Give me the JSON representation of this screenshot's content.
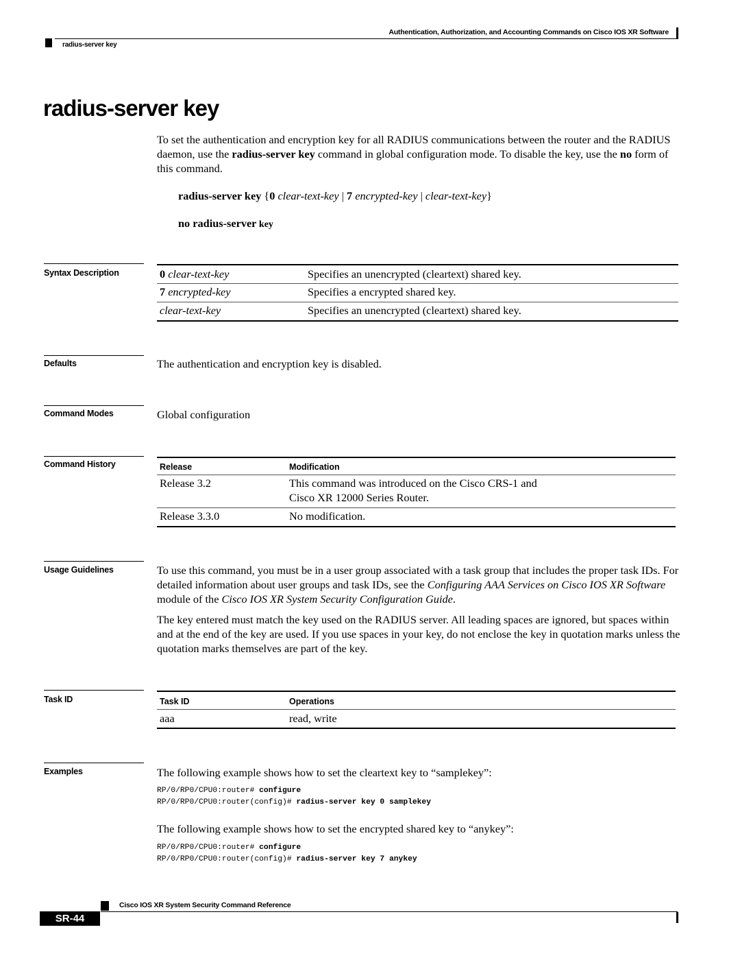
{
  "header": {
    "chapter_title": "Authentication, Authorization, and Accounting Commands on Cisco IOS XR Software",
    "section_label": "radius-server key"
  },
  "title": "radius-server key",
  "intro": {
    "part1": "To set the authentication and encryption key for all RADIUS communications between the router and the RADIUS daemon, use the ",
    "cmd": "radius-server key",
    "part2": " command in global configuration mode. To disable the key, use the ",
    "no": "no",
    "part3": " form of this command."
  },
  "syntax": {
    "line1": {
      "cmd": "radius-server key",
      "open": " {",
      "opt0": "0",
      "arg0": " clear-text-key",
      "sep1": " | ",
      "opt7": "7",
      "arg7": " encrypted-key",
      "sep2": " | ",
      "arg_plain": "clear-text-key",
      "close": "}"
    },
    "line2": {
      "no_cmd": "no radius-server",
      "key": " key"
    }
  },
  "sections": {
    "syntax_description": "Syntax Description",
    "defaults": "Defaults",
    "command_modes": "Command Modes",
    "command_history": "Command History",
    "usage_guidelines": "Usage Guidelines",
    "task_id": "Task ID",
    "examples": "Examples"
  },
  "syntax_table": [
    {
      "keyword": "0",
      "arg": " clear-text-key",
      "desc": "Specifies an unencrypted (cleartext) shared key."
    },
    {
      "keyword": "7",
      "arg": " encrypted-key",
      "desc": "Specifies a encrypted shared key."
    },
    {
      "keyword": "",
      "arg": "clear-text-key",
      "desc": "Specifies an unencrypted (cleartext) shared key."
    }
  ],
  "defaults_text": "The authentication and encryption key is disabled.",
  "command_modes_text": "Global configuration",
  "history_table": {
    "headers": [
      "Release",
      "Modification"
    ],
    "rows": [
      {
        "release": "Release 3.2",
        "mod_line1": "This command was introduced on the Cisco CRS-1 and",
        "mod_line2": "Cisco XR 12000 Series Router."
      },
      {
        "release": "Release 3.3.0",
        "mod_line1": "No modification.",
        "mod_line2": ""
      }
    ]
  },
  "usage": {
    "p1_a": "To use this command, you must be in a user group associated with a task group that includes the proper task IDs. For detailed information about user groups and task IDs, see the ",
    "p1_ref1": "Configuring AAA Services on Cisco IOS XR Software",
    "p1_b": " module of the ",
    "p1_ref2": "Cisco IOS XR System Security Configuration Guide",
    "p1_c": ".",
    "p2": "The key entered must match the key used on the RADIUS server. All leading spaces are ignored, but spaces within and at the end of the key are used. If you use spaces in your key, do not enclose the key in quotation marks unless the quotation marks themselves are part of the key."
  },
  "task_table": {
    "headers": [
      "Task ID",
      "Operations"
    ],
    "rows": [
      {
        "task": "aaa",
        "ops": "read, write"
      }
    ]
  },
  "examples": {
    "intro1": "The following example shows how to set the cleartext key to “samplekey”:",
    "ex1": [
      {
        "prompt": "RP/0/RP0/CPU0:router# ",
        "cmd": "configure"
      },
      {
        "prompt": "RP/0/RP0/CPU0:router(config)# ",
        "cmd": "radius-server key 0 samplekey"
      }
    ],
    "intro2": "The following example shows how to set the encrypted shared key to “anykey”:",
    "ex2": [
      {
        "prompt": "RP/0/RP0/CPU0:router# ",
        "cmd": "configure"
      },
      {
        "prompt": "RP/0/RP0/CPU0:router(config)# ",
        "cmd": "radius-server key 7 anykey"
      }
    ]
  },
  "footer": {
    "book_title": "Cisco IOS XR System Security Command Reference",
    "page_number": "SR-44"
  }
}
